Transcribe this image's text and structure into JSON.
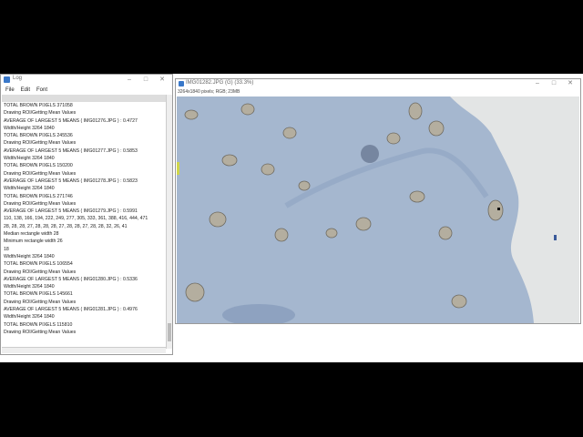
{
  "log_window": {
    "title": "Log",
    "controls": {
      "minimize": "–",
      "maximize": "□",
      "close": "✕"
    },
    "menu": [
      "File",
      "Edit",
      "Font"
    ],
    "lines": [
      "",
      "TOTAL BROWN PIXELS 371058",
      "Drawing ROI/Getting Mean Values",
      "AVERAGE OF LARGEST 5 MEANS ( IMG01276.JPG ) : 0.4727",
      "Width/Height 3264 1840",
      "TOTAL BROWN PIXELS 245536",
      "Drawing ROI/Getting Mean Values",
      "AVERAGE OF LARGEST 5 MEANS ( IMG01277.JPG ) : 0.5853",
      "Width/Height 3264 1840",
      "TOTAL BROWN PIXELS 150200",
      "Drawing ROI/Getting Mean Values",
      "AVERAGE OF LARGEST 5 MEANS ( IMG01278.JPG ) : 0.5823",
      "Width/Height 3264 1840",
      "TOTAL BROWN PIXELS 271746",
      "Drawing ROI/Getting Mean Values",
      "AVERAGE OF LARGEST 5 MEANS ( IMG01279.JPG ) : 0.5991",
      "110, 138, 166, 194, 222, 249, 277, 305, 333, 361, 388, 416, 444, 471",
      "28, 28, 28, 27, 28, 28, 28, 27, 28, 28, 27, 28, 28, 32, 26, 41",
      "Median rectangle width 28",
      "Minimum rectangle width 26",
      "18",
      "Width/Height 3264 1840",
      "TOTAL BROWN PIXELS 106554",
      "Drawing ROI/Getting Mean Values",
      "AVERAGE OF LARGEST 5 MEANS ( IMG01280.JPG ) : 0.5336",
      "Width/Height 3264 1840",
      "TOTAL BROWN PIXELS 145661",
      "Drawing ROI/Getting Mean Values",
      "AVERAGE OF LARGEST 5 MEANS ( IMG01281.JPG ) : 0.4976",
      "Width/Height 3264 1840",
      "TOTAL BROWN PIXELS 115810",
      "Drawing ROI/Getting Mean Values",
      ""
    ]
  },
  "image_window": {
    "title": "IMG01282.JPG (G) (33.3%)",
    "controls": {
      "minimize": "–",
      "maximize": "□",
      "close": "✕"
    },
    "info": "3264x1840 pixels; RGB; 23MB",
    "colors": {
      "background": "#e2e4e4",
      "stain": "#a4b6cf",
      "stain_dark": "#8fa5c4",
      "cell": "#9e9a8f"
    }
  }
}
